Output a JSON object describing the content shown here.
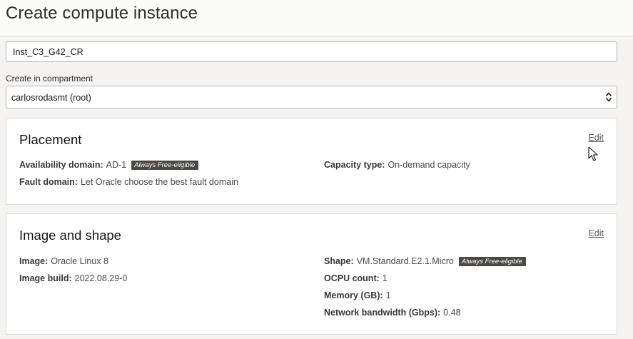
{
  "page": {
    "title": "Create compute instance"
  },
  "name_field": {
    "value": "Inst_C3_G42_CR"
  },
  "compartment": {
    "label": "Create in compartment",
    "selected": "carlosrodasmt (root)"
  },
  "placement": {
    "title": "Placement",
    "edit_label": "Edit",
    "availability_domain": {
      "key": "Availability domain:",
      "value": "AD-1",
      "badge": "Always Free-eligible"
    },
    "capacity_type": {
      "key": "Capacity type:",
      "value": "On-demand capacity"
    },
    "fault_domain": {
      "key": "Fault domain:",
      "value": "Let Oracle choose the best fault domain"
    }
  },
  "image_shape": {
    "title": "Image and shape",
    "edit_label": "Edit",
    "image": {
      "key": "Image:",
      "value": "Oracle Linux 8"
    },
    "image_build": {
      "key": "Image build:",
      "value": "2022.08.29-0"
    },
    "shape": {
      "key": "Shape:",
      "value": "VM.Standard.E2.1.Micro",
      "badge": "Always Free-eligible"
    },
    "ocpu_count": {
      "key": "OCPU count:",
      "value": "1"
    },
    "memory": {
      "key": "Memory (GB):",
      "value": "1"
    },
    "network_bandwidth": {
      "key": "Network bandwidth (Gbps):",
      "value": "0.48"
    }
  },
  "icons": {
    "select_arrows": "chevron-up-down-icon",
    "cursor": "mouse-pointer-icon"
  },
  "colors": {
    "badge_bg": "#4b4845",
    "card_bg": "#ffffff",
    "page_bg": "#f5f4f2"
  }
}
